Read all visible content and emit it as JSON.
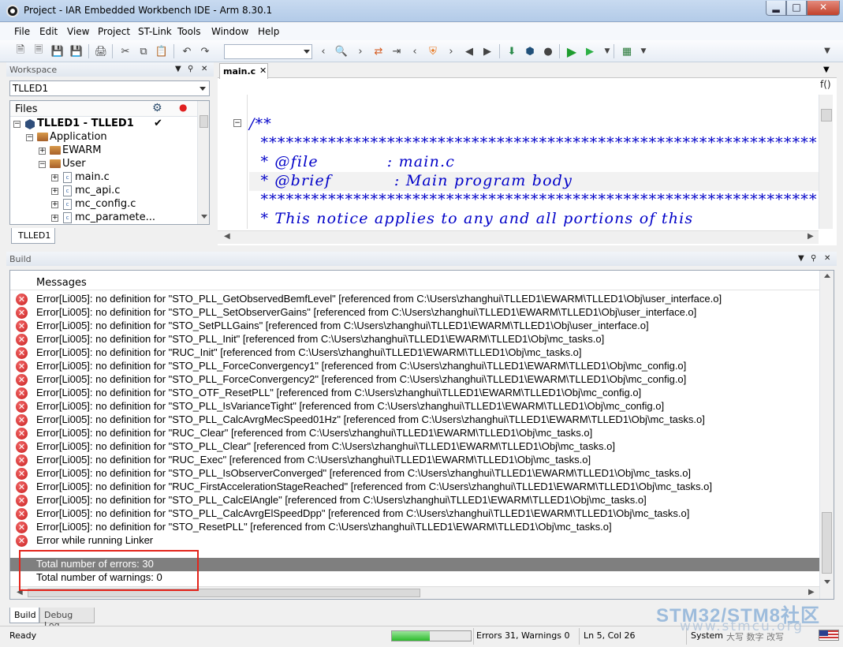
{
  "window": {
    "title": "Project - IAR Embedded Workbench IDE - Arm 8.30.1",
    "min": "▂",
    "max": "□",
    "close": "✕"
  },
  "menu": [
    "File",
    "Edit",
    "View",
    "Project",
    "ST-Link",
    "Tools",
    "Window",
    "Help"
  ],
  "workspace": {
    "title": "Workspace",
    "config": "TLLED1",
    "files_header": "Files",
    "tree": [
      {
        "label": "TLLED1 - TLLED1",
        "check": "✔"
      },
      {
        "label": "Application"
      },
      {
        "label": "EWARM"
      },
      {
        "label": "User"
      },
      {
        "label": "main.c"
      },
      {
        "label": "mc_api.c"
      },
      {
        "label": "mc_config.c"
      },
      {
        "label": "mc_paramete..."
      }
    ],
    "tab": "TLLED1"
  },
  "editor": {
    "tab": "main.c",
    "fx": "f()",
    "lines": [
      "/**",
      "  ******************************************************************",
      "  * @file            : main.c",
      "  * @brief           : Main program body",
      "  ******************************************************************",
      "  * This notice applies to any and all portions of this"
    ]
  },
  "build": {
    "title": "Build",
    "messages_header": "Messages",
    "errors": [
      "Error[Li005]: no definition for \"STO_PLL_GetObservedBemfLevel\" [referenced from C:\\Users\\zhanghui\\TLLED1\\EWARM\\TLLED1\\Obj\\user_interface.o]",
      "Error[Li005]: no definition for \"STO_PLL_SetObserverGains\" [referenced from C:\\Users\\zhanghui\\TLLED1\\EWARM\\TLLED1\\Obj\\user_interface.o]",
      "Error[Li005]: no definition for \"STO_SetPLLGains\" [referenced from C:\\Users\\zhanghui\\TLLED1\\EWARM\\TLLED1\\Obj\\user_interface.o]",
      "Error[Li005]: no definition for \"STO_PLL_Init\" [referenced from C:\\Users\\zhanghui\\TLLED1\\EWARM\\TLLED1\\Obj\\mc_tasks.o]",
      "Error[Li005]: no definition for \"RUC_Init\" [referenced from C:\\Users\\zhanghui\\TLLED1\\EWARM\\TLLED1\\Obj\\mc_tasks.o]",
      "Error[Li005]: no definition for \"STO_PLL_ForceConvergency1\" [referenced from C:\\Users\\zhanghui\\TLLED1\\EWARM\\TLLED1\\Obj\\mc_config.o]",
      "Error[Li005]: no definition for \"STO_PLL_ForceConvergency2\" [referenced from C:\\Users\\zhanghui\\TLLED1\\EWARM\\TLLED1\\Obj\\mc_config.o]",
      "Error[Li005]: no definition for \"STO_OTF_ResetPLL\" [referenced from C:\\Users\\zhanghui\\TLLED1\\EWARM\\TLLED1\\Obj\\mc_config.o]",
      "Error[Li005]: no definition for \"STO_PLL_IsVarianceTight\" [referenced from C:\\Users\\zhanghui\\TLLED1\\EWARM\\TLLED1\\Obj\\mc_config.o]",
      "Error[Li005]: no definition for \"STO_PLL_CalcAvrgMecSpeed01Hz\" [referenced from C:\\Users\\zhanghui\\TLLED1\\EWARM\\TLLED1\\Obj\\mc_tasks.o]",
      "Error[Li005]: no definition for \"RUC_Clear\" [referenced from C:\\Users\\zhanghui\\TLLED1\\EWARM\\TLLED1\\Obj\\mc_tasks.o]",
      "Error[Li005]: no definition for \"STO_PLL_Clear\" [referenced from C:\\Users\\zhanghui\\TLLED1\\EWARM\\TLLED1\\Obj\\mc_tasks.o]",
      "Error[Li005]: no definition for \"RUC_Exec\" [referenced from C:\\Users\\zhanghui\\TLLED1\\EWARM\\TLLED1\\Obj\\mc_tasks.o]",
      "Error[Li005]: no definition for \"STO_PLL_IsObserverConverged\" [referenced from C:\\Users\\zhanghui\\TLLED1\\EWARM\\TLLED1\\Obj\\mc_tasks.o]",
      "Error[Li005]: no definition for \"RUC_FirstAccelerationStageReached\" [referenced from C:\\Users\\zhanghui\\TLLED1\\EWARM\\TLLED1\\Obj\\mc_tasks.o]",
      "Error[Li005]: no definition for \"STO_PLL_CalcElAngle\" [referenced from C:\\Users\\zhanghui\\TLLED1\\EWARM\\TLLED1\\Obj\\mc_tasks.o]",
      "Error[Li005]: no definition for \"STO_PLL_CalcAvrgElSpeedDpp\" [referenced from C:\\Users\\zhanghui\\TLLED1\\EWARM\\TLLED1\\Obj\\mc_tasks.o]",
      "Error[Li005]: no definition for \"STO_ResetPLL\" [referenced from C:\\Users\\zhanghui\\TLLED1\\EWARM\\TLLED1\\Obj\\mc_tasks.o]",
      "Error while running Linker"
    ],
    "total_errors": "Total number of errors: 30",
    "total_warnings": "Total number of warnings: 0",
    "tabs": [
      "Build",
      "Debug Log"
    ]
  },
  "status": {
    "ready": "Ready",
    "progress": 0.48,
    "counts": "Errors 31, Warnings 0",
    "position": "Ln 5, Col 26",
    "system": "System",
    "indicators": "大写  数字  改写"
  },
  "watermark": {
    "text": "STM32/STM8社区",
    "url": "www.stmcu.org"
  }
}
